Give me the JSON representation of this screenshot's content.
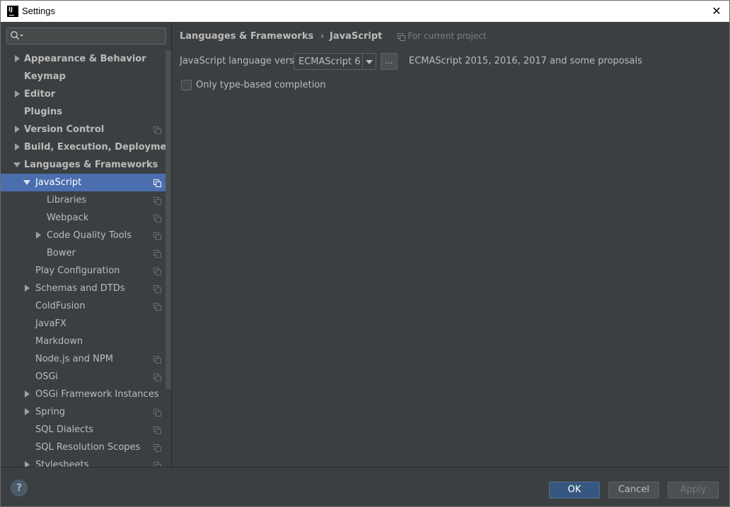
{
  "window": {
    "title": "Settings",
    "app_icon": "intellij-idea-icon",
    "close_glyph": "✕"
  },
  "sidebar": {
    "search": {
      "value": "",
      "placeholder": "",
      "icon": "search-icon"
    },
    "items": [
      {
        "label": "Appearance & Behavior",
        "level": 0,
        "expander": "collapsed",
        "bold": true,
        "project_scope": false
      },
      {
        "label": "Keymap",
        "level": 0,
        "expander": "none",
        "bold": true,
        "project_scope": false
      },
      {
        "label": "Editor",
        "level": 0,
        "expander": "collapsed",
        "bold": true,
        "project_scope": false
      },
      {
        "label": "Plugins",
        "level": 0,
        "expander": "none",
        "bold": true,
        "project_scope": false
      },
      {
        "label": "Version Control",
        "level": 0,
        "expander": "collapsed",
        "bold": true,
        "project_scope": true
      },
      {
        "label": "Build, Execution, Deployment",
        "level": 0,
        "expander": "collapsed",
        "bold": true,
        "project_scope": false
      },
      {
        "label": "Languages & Frameworks",
        "level": 0,
        "expander": "expanded",
        "bold": true,
        "project_scope": false
      },
      {
        "label": "JavaScript",
        "level": 1,
        "expander": "expanded",
        "bold": false,
        "project_scope": true,
        "selected": true
      },
      {
        "label": "Libraries",
        "level": 2,
        "expander": "none",
        "bold": false,
        "project_scope": true
      },
      {
        "label": "Webpack",
        "level": 2,
        "expander": "none",
        "bold": false,
        "project_scope": true
      },
      {
        "label": "Code Quality Tools",
        "level": 2,
        "expander": "collapsed",
        "bold": false,
        "project_scope": true
      },
      {
        "label": "Bower",
        "level": 2,
        "expander": "none",
        "bold": false,
        "project_scope": true
      },
      {
        "label": "Play Configuration",
        "level": 1,
        "expander": "none",
        "bold": false,
        "project_scope": true
      },
      {
        "label": "Schemas and DTDs",
        "level": 1,
        "expander": "collapsed",
        "bold": false,
        "project_scope": true
      },
      {
        "label": "ColdFusion",
        "level": 1,
        "expander": "none",
        "bold": false,
        "project_scope": true
      },
      {
        "label": "JavaFX",
        "level": 1,
        "expander": "none",
        "bold": false,
        "project_scope": false
      },
      {
        "label": "Markdown",
        "level": 1,
        "expander": "none",
        "bold": false,
        "project_scope": false
      },
      {
        "label": "Node.js and NPM",
        "level": 1,
        "expander": "none",
        "bold": false,
        "project_scope": true
      },
      {
        "label": "OSGi",
        "level": 1,
        "expander": "none",
        "bold": false,
        "project_scope": true
      },
      {
        "label": "OSGi Framework Instances",
        "level": 1,
        "expander": "collapsed",
        "bold": false,
        "project_scope": false
      },
      {
        "label": "Spring",
        "level": 1,
        "expander": "collapsed",
        "bold": false,
        "project_scope": true
      },
      {
        "label": "SQL Dialects",
        "level": 1,
        "expander": "none",
        "bold": false,
        "project_scope": true
      },
      {
        "label": "SQL Resolution Scopes",
        "level": 1,
        "expander": "none",
        "bold": false,
        "project_scope": true
      },
      {
        "label": "Stylesheets",
        "level": 1,
        "expander": "collapsed",
        "bold": false,
        "project_scope": true
      }
    ]
  },
  "main": {
    "breadcrumb": {
      "parent": "Languages & Frameworks",
      "separator": "›",
      "current": "JavaScript",
      "scope": "For current project"
    },
    "language_version": {
      "label": "JavaScript language version",
      "selected": "ECMAScript 6",
      "more_button": "...",
      "description": "ECMAScript 2015, 2016, 2017 and some proposals"
    },
    "only_type_based": {
      "label": "Only type-based completion",
      "checked": false
    }
  },
  "footer": {
    "help": "?",
    "ok": "OK",
    "cancel": "Cancel",
    "apply": "Apply"
  },
  "colors": {
    "background": "#3c3f41",
    "selection": "#4b6eaf",
    "ok_button": "#365880",
    "text": "#bbbbbb"
  }
}
